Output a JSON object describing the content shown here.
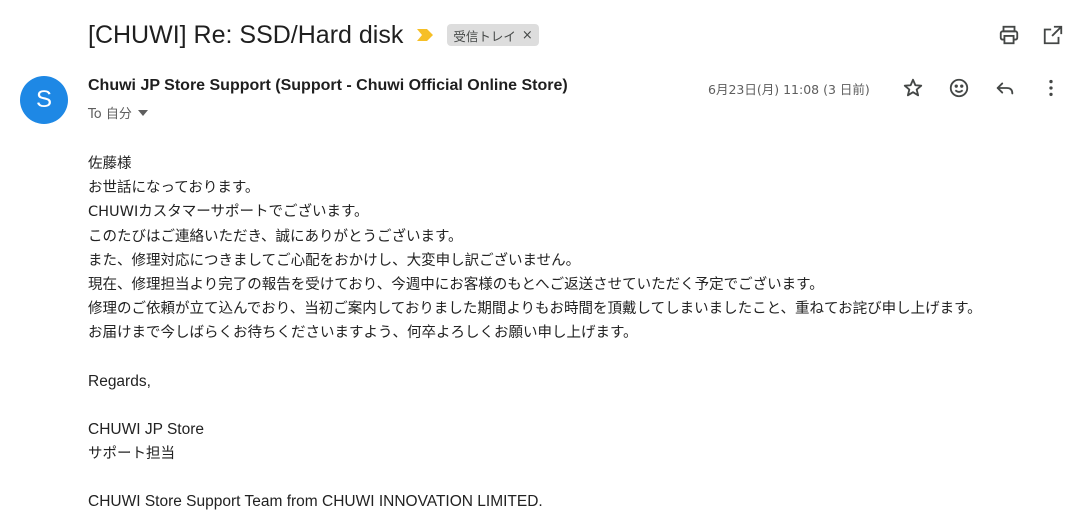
{
  "email": {
    "subject": "[CHUWI] Re: SSD/Hard disk",
    "label_chip": "受信トレイ",
    "label_close": "×",
    "sender_initial": "S",
    "sender": "Chuwi JP Store Support (Support - Chuwi Official Online Store)",
    "to_line": "To 自分",
    "date": "6月23日(月) 11:08 (3 日前)"
  },
  "icons": {
    "importance": "importance-marker-icon",
    "print": "print-icon",
    "open_new_window": "open-in-new-window-icon",
    "star": "star-icon",
    "emoji": "emoji-reaction-icon",
    "reply": "reply-icon",
    "more": "more-vertical-icon",
    "dropdown": "caret-down-icon"
  },
  "colors": {
    "avatar": "#1e88e5",
    "importance": "#f6bf26",
    "chip": "#dddddd"
  },
  "body": {
    "greeting": "佐藤様",
    "lines": [
      "お世話になっております。",
      "CHUWIカスタマーサポートでございます。",
      "このたびはご連絡いただき、誠にありがとうございます。",
      "また、修理対応につきましてご心配をおかけし、大変申し訳ございません。",
      "現在、修理担当より完了の報告を受けており、今週中にお客様のもとへご返送させていただく予定でございます。",
      "修理のご依頼が立て込んでおり、当初ご案内しておりました期間よりもお時間を頂戴してしまいましたこと、重ねてお詫び申し上げます。",
      "お届けまで今しばらくお待ちくださいますよう、何卒よろしくお願い申し上げます。"
    ],
    "regards": "Regards,",
    "signature_store": "CHUWI JP Store",
    "signature_dept": "サポート担当",
    "footer": "CHUWI Store Support Team from CHUWI INNOVATION LIMITED."
  }
}
